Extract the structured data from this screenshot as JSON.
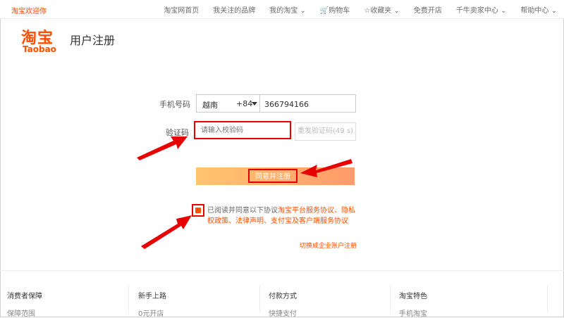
{
  "topbar": {
    "welcome": "淘宝欢迎你",
    "links": [
      "淘宝网首页",
      "我关注的品牌",
      "我的淘宝",
      "购物车",
      "收藏夹",
      "免费开店",
      "千牛卖家中心",
      "帮助中心"
    ]
  },
  "logo": {
    "cn": "淘宝",
    "en": "Taobao"
  },
  "page_title": "用户注册",
  "form": {
    "phone_label": "手机号码",
    "country": "越南",
    "country_code": "+84",
    "phone_value": "366794166",
    "code_label": "验证码",
    "code_placeholder": "请输入校验码",
    "resend_label": "重发验证码(49 s)",
    "submit_label": "同意并注册"
  },
  "agreement": {
    "prefix": "已阅读并同意以下协议",
    "terms": "淘宝平台服务协议、隐私权政策、法律声明、支付宝及客户端服务协议"
  },
  "enterprise_link": "切换成企业账户注册",
  "footer": {
    "columns": [
      {
        "title": "消费者保障",
        "item": "保障范围"
      },
      {
        "title": "新手上路",
        "item": "0元开店"
      },
      {
        "title": "付款方式",
        "item": "快捷支付"
      },
      {
        "title": "淘宝特色",
        "item": "手机淘宝"
      }
    ]
  },
  "colors": {
    "accent": "#ff5000",
    "annotation": "#e60000"
  }
}
